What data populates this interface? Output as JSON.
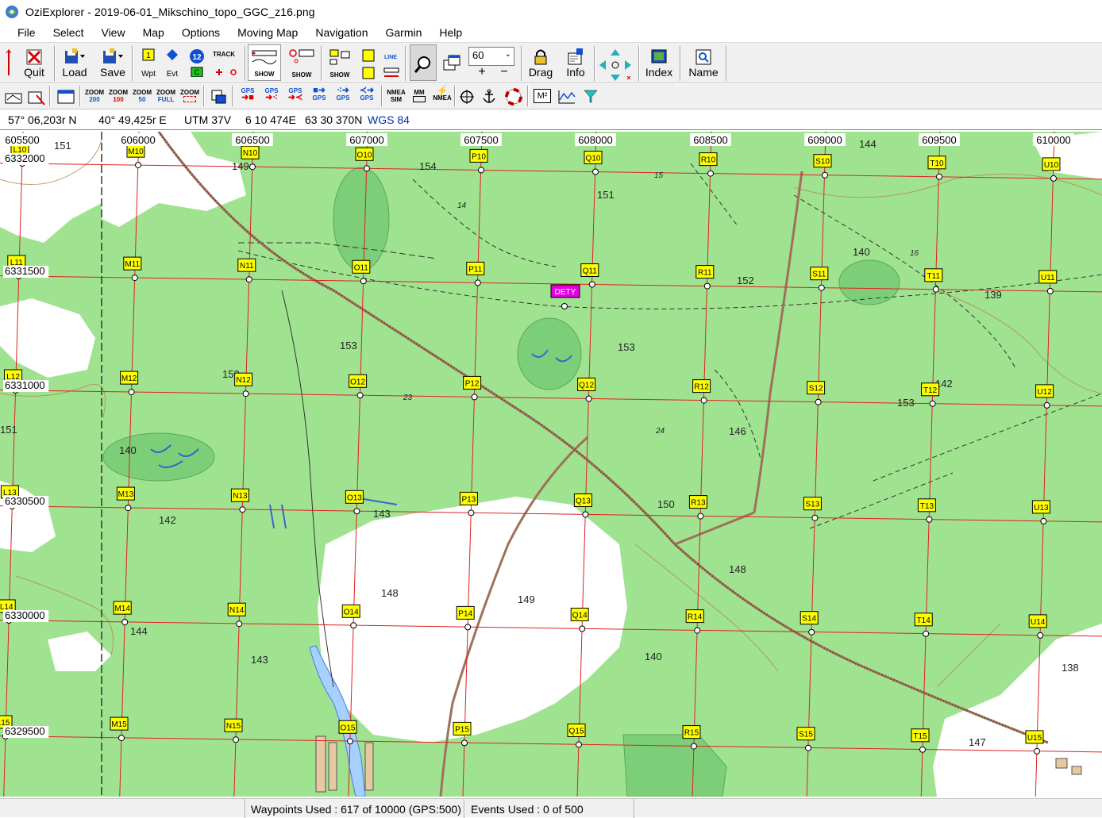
{
  "window": {
    "title": "OziExplorer - 2019-06-01_Mikschino_topo_GGC_z16.png"
  },
  "menu": [
    "File",
    "Select",
    "View",
    "Map",
    "Options",
    "Moving Map",
    "Navigation",
    "Garmin",
    "Help"
  ],
  "toolbar1": {
    "quit": "Quit",
    "load": "Load",
    "save": "Save",
    "wpt": "Wpt",
    "evt": "Evt",
    "track": "TRACK",
    "show1": "SHOW",
    "show2": "SHOW",
    "show3": "SHOW",
    "line": "LINE",
    "zoom_value": "60",
    "drag": "Drag",
    "info": "Info",
    "index": "Index",
    "name": "Name"
  },
  "toolbar2": {
    "zoom_labels": [
      {
        "top": "ZOOM",
        "bottom": "200"
      },
      {
        "top": "ZOOM",
        "bottom": "100"
      },
      {
        "top": "ZOOM",
        "bottom": "50"
      },
      {
        "top": "ZOOM",
        "bottom": "FULL"
      },
      {
        "top": "ZOOM",
        "bottom": ""
      }
    ],
    "gps_labels": [
      "GPS",
      "GPS",
      "GPS",
      "GPS",
      "GPS",
      "GPS"
    ],
    "nmea_sim": {
      "top": "NMEA",
      "bottom": "SIM"
    },
    "mm_label": "MM",
    "nmea": "NMEA",
    "m2": "M²"
  },
  "position": {
    "lat": "57° 06,203r N",
    "lon": "40° 49,425r E",
    "utm_zone": "UTM  37V",
    "easting": "6 10 474E",
    "northing": "63 30 370N",
    "datum": "WGS 84"
  },
  "map": {
    "x_labels": [
      "605500",
      "606000",
      "606500",
      "607000",
      "607500",
      "608000",
      "608500",
      "609000",
      "609500",
      "610000"
    ],
    "y_labels": [
      "6331000",
      "6331500",
      "6331000",
      "6330500",
      "6330000",
      "6329500"
    ],
    "y_labels_display": [
      "6332000",
      "6331500",
      "6331000",
      "6330500",
      "6330000",
      "6329500"
    ],
    "columns": [
      "L",
      "M",
      "N",
      "O",
      "P",
      "Q",
      "R",
      "S",
      "T",
      "U"
    ],
    "rows": [
      "10",
      "11",
      "12",
      "13",
      "14",
      "15"
    ],
    "special_waypoint": "DETY",
    "elevations": [
      "151",
      "149",
      "154",
      "151",
      "140",
      "152",
      "139",
      "153",
      "153",
      "152",
      "142",
      "146",
      "151",
      "140",
      "143",
      "142",
      "150",
      "148",
      "148",
      "149",
      "144",
      "143",
      "140",
      "138",
      "147",
      "144",
      "15",
      "16",
      "14",
      "23",
      "24",
      "153"
    ],
    "colors": {
      "forest": "#9fe390",
      "open": "#ffffff",
      "grid": "#e02020",
      "waypoint_fill": "#ffff00",
      "special_fill": "#e000e0",
      "track": "#b07050"
    }
  },
  "statusbar": {
    "waypoints": "Waypoints Used : 617 of 10000  (GPS:500)",
    "events": "Events Used : 0 of 500"
  }
}
